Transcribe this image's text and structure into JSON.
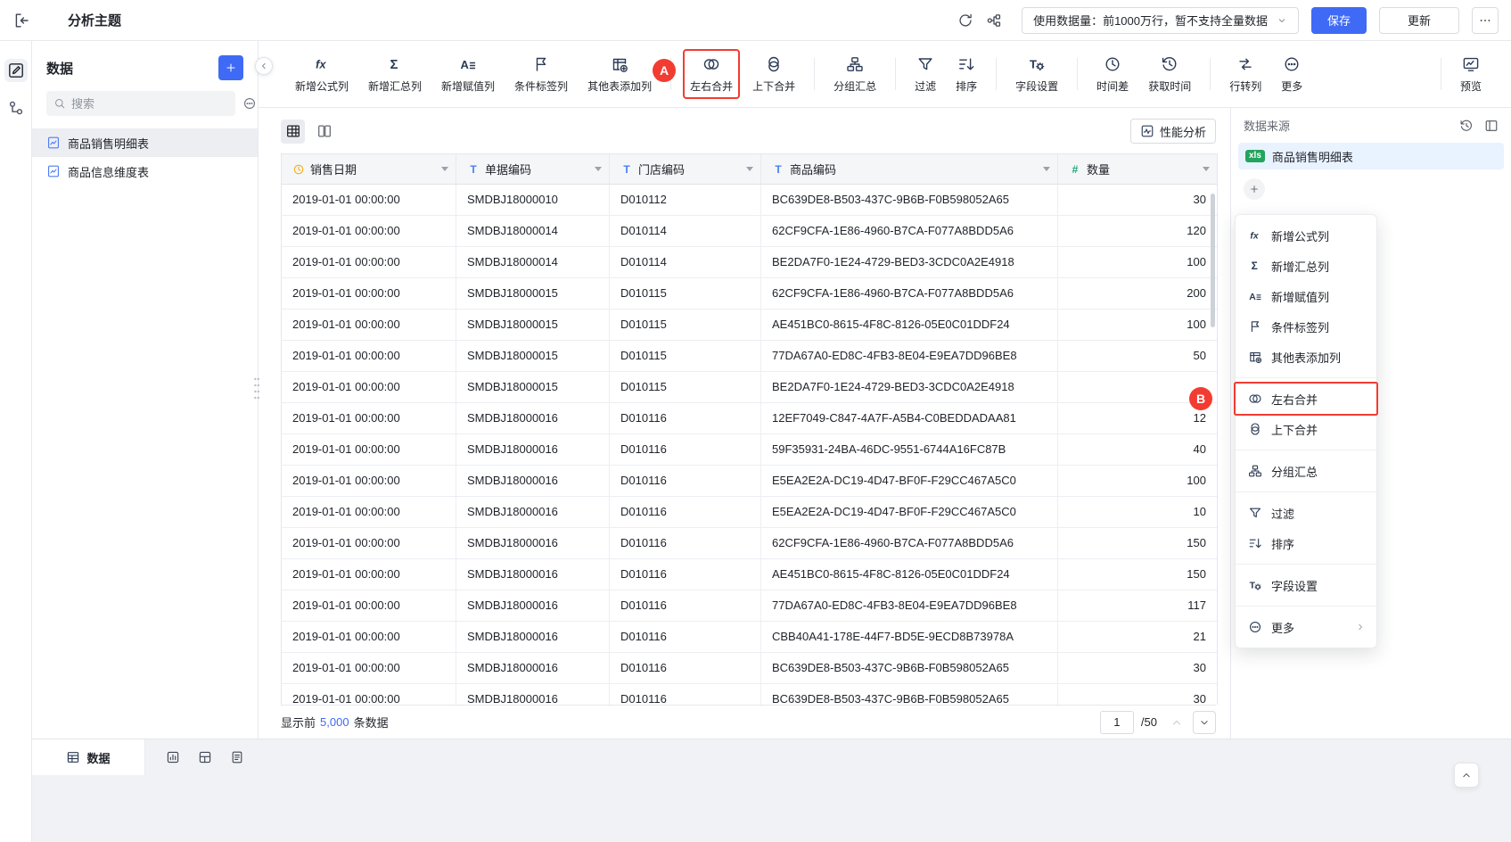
{
  "topbar": {
    "title": "分析主题",
    "data_limit_label": "使用数据量：前1000万行，暂不支持全量数据",
    "save_label": "保存",
    "update_label": "更新"
  },
  "toolbar": {
    "groups": [
      [
        {
          "icon": "fx",
          "label": "新增公式列"
        },
        {
          "icon": "sigma",
          "label": "新增汇总列"
        },
        {
          "icon": "assign",
          "label": "新增赋值列"
        },
        {
          "icon": "tag",
          "label": "条件标签列"
        },
        {
          "icon": "table-add",
          "label": "其他表添加列"
        }
      ],
      [
        {
          "icon": "merge-lr",
          "label": "左右合并",
          "highlight": true,
          "badge": "A"
        },
        {
          "icon": "merge-tb",
          "label": "上下合并"
        }
      ],
      [
        {
          "icon": "group",
          "label": "分组汇总"
        }
      ],
      [
        {
          "icon": "filter",
          "label": "过滤"
        },
        {
          "icon": "sort",
          "label": "排序"
        }
      ],
      [
        {
          "icon": "field",
          "label": "字段设置"
        }
      ],
      [
        {
          "icon": "clock",
          "label": "时间差"
        },
        {
          "icon": "get-time",
          "label": "获取时间"
        }
      ],
      [
        {
          "icon": "transpose",
          "label": "行转列"
        },
        {
          "icon": "more",
          "label": "更多"
        }
      ]
    ],
    "preview": {
      "icon": "preview",
      "label": "预览"
    }
  },
  "sidebar": {
    "title": "数据",
    "search_placeholder": "搜索",
    "tables": [
      {
        "label": "商品销售明细表",
        "selected": true
      },
      {
        "label": "商品信息维度表",
        "selected": false
      }
    ]
  },
  "main": {
    "performance_label": "性能分析",
    "table": {
      "columns": [
        {
          "name": "销售日期",
          "type": "date"
        },
        {
          "name": "单据编码",
          "type": "text"
        },
        {
          "name": "门店编码",
          "type": "text"
        },
        {
          "name": "商品编码",
          "type": "text"
        },
        {
          "name": "数量",
          "type": "number"
        }
      ],
      "rows": [
        [
          "2019-01-01 00:00:00",
          "SMDBJ18000010",
          "D010112",
          "BC639DE8-B503-437C-9B6B-F0B598052A65",
          "30"
        ],
        [
          "2019-01-01 00:00:00",
          "SMDBJ18000014",
          "D010114",
          "62CF9CFA-1E86-4960-B7CA-F077A8BDD5A6",
          "120"
        ],
        [
          "2019-01-01 00:00:00",
          "SMDBJ18000014",
          "D010114",
          "BE2DA7F0-1E24-4729-BED3-3CDC0A2E4918",
          "100"
        ],
        [
          "2019-01-01 00:00:00",
          "SMDBJ18000015",
          "D010115",
          "62CF9CFA-1E86-4960-B7CA-F077A8BDD5A6",
          "200"
        ],
        [
          "2019-01-01 00:00:00",
          "SMDBJ18000015",
          "D010115",
          "AE451BC0-8615-4F8C-8126-05E0C01DDF24",
          "100"
        ],
        [
          "2019-01-01 00:00:00",
          "SMDBJ18000015",
          "D010115",
          "77DA67A0-ED8C-4FB3-8E04-E9EA7DD96BE8",
          "50"
        ],
        [
          "2019-01-01 00:00:00",
          "SMDBJ18000015",
          "D010115",
          "BE2DA7F0-1E24-4729-BED3-3CDC0A2E4918",
          ""
        ],
        [
          "2019-01-01 00:00:00",
          "SMDBJ18000016",
          "D010116",
          "12EF7049-C847-4A7F-A5B4-C0BEDDADAA81",
          "12"
        ],
        [
          "2019-01-01 00:00:00",
          "SMDBJ18000016",
          "D010116",
          "59F35931-24BA-46DC-9551-6744A16FC87B",
          "40"
        ],
        [
          "2019-01-01 00:00:00",
          "SMDBJ18000016",
          "D010116",
          "E5EA2E2A-DC19-4D47-BF0F-F29CC467A5C0",
          "100"
        ],
        [
          "2019-01-01 00:00:00",
          "SMDBJ18000016",
          "D010116",
          "E5EA2E2A-DC19-4D47-BF0F-F29CC467A5C0",
          "10"
        ],
        [
          "2019-01-01 00:00:00",
          "SMDBJ18000016",
          "D010116",
          "62CF9CFA-1E86-4960-B7CA-F077A8BDD5A6",
          "150"
        ],
        [
          "2019-01-01 00:00:00",
          "SMDBJ18000016",
          "D010116",
          "AE451BC0-8615-4F8C-8126-05E0C01DDF24",
          "150"
        ],
        [
          "2019-01-01 00:00:00",
          "SMDBJ18000016",
          "D010116",
          "77DA67A0-ED8C-4FB3-8E04-E9EA7DD96BE8",
          "117"
        ],
        [
          "2019-01-01 00:00:00",
          "SMDBJ18000016",
          "D010116",
          "CBB40A41-178E-44F7-BD5E-9ECD8B73978A",
          "21"
        ],
        [
          "2019-01-01 00:00:00",
          "SMDBJ18000016",
          "D010116",
          "BC639DE8-B503-437C-9B6B-F0B598052A65",
          "30"
        ],
        [
          "2019-01-01 00:00:00",
          "SMDBJ18000016",
          "D010116",
          "BC639DE8-B503-437C-9B6B-F0B598052A65",
          "30"
        ]
      ]
    },
    "footer": {
      "prefix": "显示前",
      "count": "5,000",
      "suffix": "条数据",
      "page_value": "1",
      "page_total": "/50"
    }
  },
  "right_panel": {
    "title": "数据来源",
    "source": {
      "badge": "xls",
      "label": "商品销售明细表"
    },
    "menu": {
      "groups": [
        [
          {
            "icon": "fx",
            "label": "新增公式列"
          },
          {
            "icon": "sigma",
            "label": "新增汇总列"
          },
          {
            "icon": "assign",
            "label": "新增赋值列"
          },
          {
            "icon": "tag",
            "label": "条件标签列"
          },
          {
            "icon": "table-add",
            "label": "其他表添加列"
          }
        ],
        [
          {
            "icon": "merge-lr",
            "label": "左右合并",
            "highlight": true,
            "badge": "B"
          },
          {
            "icon": "merge-tb",
            "label": "上下合并"
          }
        ],
        [
          {
            "icon": "group",
            "label": "分组汇总"
          }
        ],
        [
          {
            "icon": "filter",
            "label": "过滤"
          },
          {
            "icon": "sort",
            "label": "排序"
          }
        ],
        [
          {
            "icon": "field",
            "label": "字段设置"
          }
        ],
        [
          {
            "icon": "more",
            "label": "更多",
            "chevron": true
          }
        ]
      ]
    }
  },
  "bottom_bar": {
    "active_tab": "数据"
  },
  "colors": {
    "primary": "#3F6AF5",
    "accent_red": "#F23C31",
    "date_icon": "#F7A700",
    "text_icon": "#4D7DF2",
    "number_icon": "#1CA77C",
    "xls_green": "#22A45D"
  }
}
